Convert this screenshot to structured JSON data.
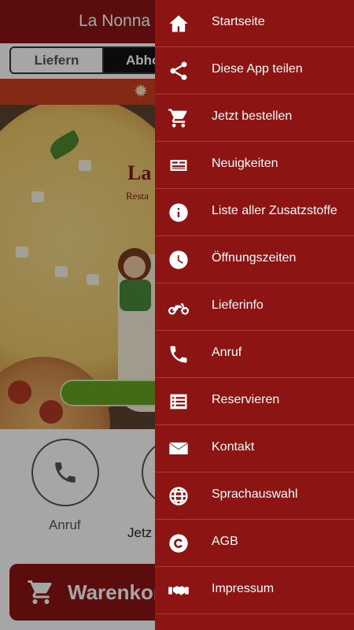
{
  "app": {
    "title": "La Nonna R"
  },
  "toggle": {
    "left_label": "Liefern",
    "right_label": "Abho"
  },
  "hero": {
    "logo_text": "La",
    "logo_sub": "Resta"
  },
  "actions": {
    "call_label": "Anruf",
    "order_label": "Jetz"
  },
  "cart": {
    "label": "Warenkor"
  },
  "colors": {
    "brand": "#8c1514",
    "promo": "#c9401f",
    "cta": "#6aa321"
  },
  "drawer": {
    "items": [
      {
        "label": "Startseite",
        "icon": "home-icon"
      },
      {
        "label": "Diese App teilen",
        "icon": "share-icon"
      },
      {
        "label": "Jetzt bestellen",
        "icon": "cart-icon"
      },
      {
        "label": "Neuigkeiten",
        "icon": "newspaper-icon"
      },
      {
        "label": "Liste aller Zusatzstoffe",
        "icon": "info-icon"
      },
      {
        "label": "Öffnungszeiten",
        "icon": "clock-icon"
      },
      {
        "label": "Lieferinfo",
        "icon": "motorcycle-icon"
      },
      {
        "label": "Anruf",
        "icon": "phone-icon"
      },
      {
        "label": "Reservieren",
        "icon": "list-icon"
      },
      {
        "label": "Kontakt",
        "icon": "envelope-icon"
      },
      {
        "label": "Sprachauswahl",
        "icon": "globe-icon"
      },
      {
        "label": "AGB",
        "icon": "copyright-icon"
      },
      {
        "label": "Impressum",
        "icon": "handshake-icon"
      }
    ]
  }
}
